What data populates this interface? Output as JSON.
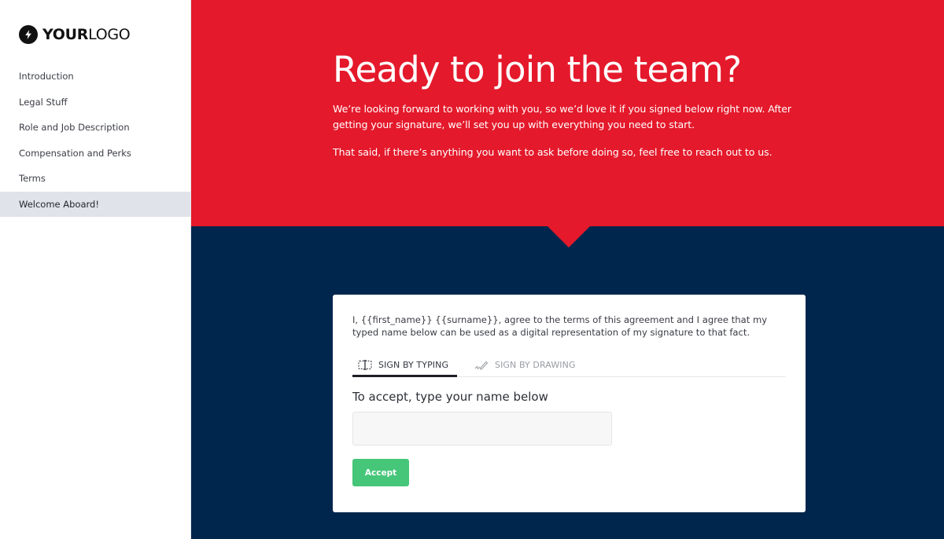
{
  "logo": {
    "bold_text": "YOUR",
    "light_text": "LOGO",
    "icon": "lightning-bolt-icon"
  },
  "sidebar": {
    "items": [
      {
        "label": "Introduction",
        "active": false
      },
      {
        "label": "Legal Stuff",
        "active": false
      },
      {
        "label": "Role and Job Description",
        "active": false
      },
      {
        "label": "Compensation and Perks",
        "active": false
      },
      {
        "label": "Terms",
        "active": false
      },
      {
        "label": "Welcome Aboard!",
        "active": true
      }
    ]
  },
  "hero": {
    "title": "Ready to join the team?",
    "paragraph1": "We’re looking forward to working with you, so we’d love it if you signed below right now. After getting your signature, we’ll set you up with everything you need to start.",
    "paragraph2": "That said, if there’s anything you want to ask before doing so, feel free to reach out to us."
  },
  "signature_card": {
    "agreement_text": "I, {{first_name}} {{surname}}, agree to the terms of this agreement and I agree that my typed name below can be used as a digital representation of my signature to that fact.",
    "tabs": [
      {
        "label": "SIGN BY TYPING",
        "icon": "text-cursor-icon",
        "active": true
      },
      {
        "label": "SIGN BY DRAWING",
        "icon": "pen-signature-icon",
        "active": false
      }
    ],
    "heading": "To accept, type your name below",
    "name_input": {
      "value": "",
      "placeholder": ""
    },
    "accept_label": "Accept"
  },
  "colors": {
    "hero_red": "#e4192b",
    "navy": "#00264d",
    "accept_green": "#46c679",
    "active_nav_bg": "#e1e3ea"
  }
}
